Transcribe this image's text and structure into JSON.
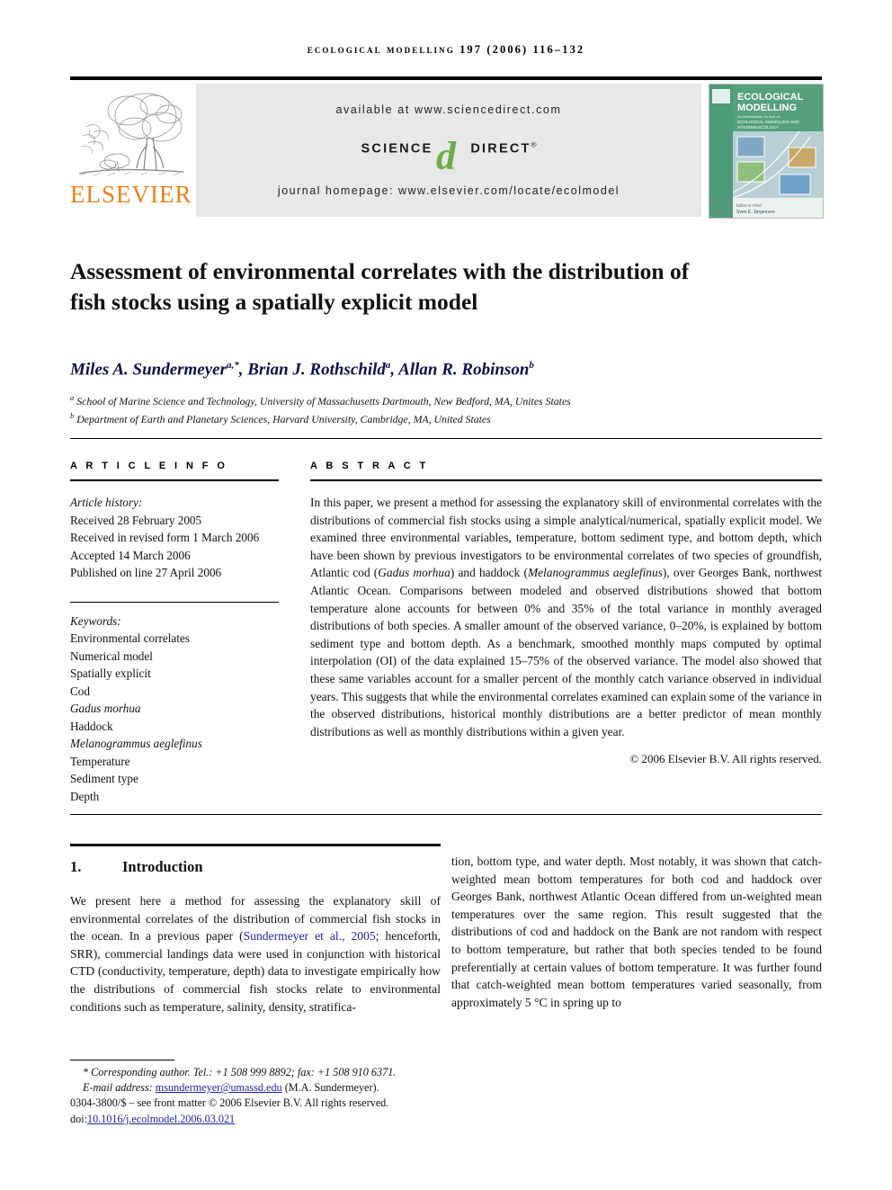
{
  "running_head": "ecological modelling 197 (2006) 116–132",
  "banner": {
    "publisher_name": "ELSEVIER",
    "publisher_logo_icon": "elsevier-tree-icon",
    "available_at": "available at www.sciencedirect.com",
    "sciencedirect_left": "SCIENCE",
    "sciencedirect_right": "DIRECT",
    "sciencedirect_mark": "d",
    "registered_mark": "®",
    "journal_homepage": "journal homepage: www.elsevier.com/locate/ecolmodel",
    "cover": {
      "title_line1": "ECOLOGICAL",
      "title_line2": "MODELLING",
      "subtitle_line1": "An International Journal on",
      "subtitle_line2": "ECOLOGICAL MODELLING AND",
      "subtitle_line3": "SYSTEMS ECOLOGY",
      "editor_label": "Editor-in-Chief",
      "editor_name": "Sven E. Jørgensen"
    }
  },
  "article": {
    "title": "Assessment of environmental correlates with the distribution of fish stocks using a spatially explicit model",
    "authors_html": "Miles A. Sundermeyer<sup>a,*</sup>, Brian J. Rothschild<sup>a</sup>, Allan R. Robinson<sup>b</sup>",
    "affiliations": [
      {
        "marker": "a",
        "text": "School of Marine Science and Technology, University of Massachusetts Dartmouth, New Bedford, MA, Unites States"
      },
      {
        "marker": "b",
        "text": "Department of Earth and Planetary Sciences, Harvard University, Cambridge, MA, United States"
      }
    ]
  },
  "article_info": {
    "heading": "A R T I C L E   I N F O",
    "history_label": "Article history:",
    "history": [
      "Received 28 February 2005",
      "Received in revised form 1 March 2006",
      "Accepted 14 March 2006",
      "Published on line 27 April 2006"
    ],
    "keywords_label": "Keywords:",
    "keywords": [
      {
        "text": "Environmental correlates",
        "italic": false
      },
      {
        "text": "Numerical model",
        "italic": false
      },
      {
        "text": "Spatially explicit",
        "italic": false
      },
      {
        "text": "Cod",
        "italic": false
      },
      {
        "text": "Gadus morhua",
        "italic": true
      },
      {
        "text": "Haddock",
        "italic": false
      },
      {
        "text": "Melanogrammus aeglefinus",
        "italic": true
      },
      {
        "text": "Temperature",
        "italic": false
      },
      {
        "text": "Sediment type",
        "italic": false
      },
      {
        "text": "Depth",
        "italic": false
      }
    ]
  },
  "abstract": {
    "heading": "A B S T R A C T",
    "body_html": "In this paper, we present a method for assessing the explanatory skill of environmental correlates with the distributions of commercial fish stocks using a simple analytical/numerical, spatially explicit model. We examined three environmental variables, temperature, bottom sediment type, and bottom depth, which have been shown by previous investigators to be environmental correlates of two species of groundfish, Atlantic cod (<i>Gadus morhua</i>) and haddock (<i>Melanogrammus aeglefinus</i>), over Georges Bank, northwest Atlantic Ocean. Comparisons between modeled and observed distributions showed that bottom temperature alone accounts for between 0% and 35% of the total variance in monthly averaged distributions of both species. A smaller amount of the observed variance, 0–20%, is explained by bottom sediment type and bottom depth. As a benchmark, smoothed monthly maps computed by optimal interpolation (OI) of the data explained 15–75% of the observed variance. The model also showed that these same variables account for a smaller percent of the monthly catch variance observed in individual years. This suggests that while the environmental correlates examined can explain some of the variance in the observed distributions, historical monthly distributions are a better predictor of mean monthly distributions as well as monthly distributions within a given year.",
    "copyright": "© 2006 Elsevier B.V. All rights reserved."
  },
  "introduction": {
    "number": "1.",
    "heading": "Introduction",
    "left_column_html": "We present here a method for assessing the explanatory skill of environmental correlates of the distribution of commercial fish stocks in the ocean. In a previous paper (<span class=\"cite\">Sundermeyer et al., 2005</span>; henceforth, SRR), commercial landings data were used in conjunction with historical CTD (conductivity, temperature, depth) data to investigate empirically how the distributions of commercial fish stocks relate to environmental conditions such as temperature, salinity, density, stratifica-",
    "right_column_html": "tion, bottom type, and water depth. Most notably, it was shown that catch-weighted mean bottom temperatures for both cod and haddock over Georges Bank, northwest Atlantic Ocean differed from un-weighted mean temperatures over the same region. This result suggested that the distributions of cod and haddock on the Bank are not random with respect to bottom temperature, but rather that both species tended to be found preferentially at certain values of bottom temperature. It was further found that catch-weighted mean bottom temperatures varied seasonally, from approximately 5 °C in spring up to"
  },
  "footer": {
    "corresponding_author": "* Corresponding author. Tel.: +1 508 999 8892; fax: +1 508 910 6371.",
    "email_label": "E-mail address:",
    "email": "msundermeyer@umassd.edu",
    "email_owner": "(M.A. Sundermeyer).",
    "front_matter": "0304-3800/$ – see front matter © 2006 Elsevier B.V. All rights reserved.",
    "doi_label": "doi:",
    "doi": "10.1016/j.ecolmodel.2006.03.021"
  },
  "colors": {
    "elsevier_orange": "#F07F1A",
    "sciencedirect_green": "#6BAE45",
    "link_blue": "#2323a8",
    "author_navy": "#10104a",
    "banner_gray": "#e8e8e8"
  }
}
